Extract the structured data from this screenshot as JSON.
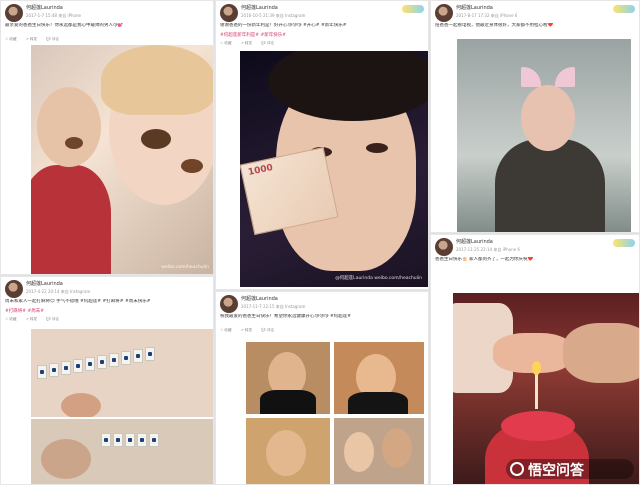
{
  "posts": [
    {
      "username": "何超莲Laurinda",
      "meta": "2017-1-7 15:48 来自 iPhone",
      "text": "最亲爱的爸爸生日快乐！你永远都是我心中最帅的男人😘💕",
      "tags": "",
      "watermark": "weibo.com/heachulin",
      "face_marks": [
        "◕ᴥ◕",
        "• •"
      ]
    },
    {
      "username": "何超莲Laurinda",
      "meta": "2016-10-5 21:39 来自 Instagram",
      "text": "谢谢爸爸的一份新年利是！好开心😘😘😘 #开心# #新年快乐#",
      "tags": "#何超莲新年利是# #新年快乐#",
      "watermark": "@何超莲Laurinda weibo.com/heachulin",
      "note_label": "1000"
    },
    {
      "username": "何超莲Laurinda",
      "meta": "2017-8-17 17:32 来自 iPhone 6",
      "text": "陪爸爸一起看电视，他最近身体很好，大家都不用担心啦❤️",
      "tags": "",
      "watermark": ""
    },
    {
      "username": "何超莲Laurinda",
      "meta": "2017-4-22 20:14 来自 Instagram",
      "text": "周末和家人一起打麻将😊 手气不错哦 #何超莲# #打麻将# #周末快乐#",
      "tags": "#打麻将# #周末#",
      "watermark": ""
    },
    {
      "username": "何超莲Laurinda",
      "meta": "2017-11-7 22:15 来自 Instagram",
      "text": "祝我最爱的爸爸生日快乐！希望你永远健康开心😘😘😘 #何超莲#",
      "tags": "",
      "watermark": ""
    },
    {
      "username": "何超莲Laurinda",
      "meta": "2017-11-25 22:14 来自 iPhone 6",
      "text": "爸爸生日快乐🎂 家人都到齐了，一起为你庆祝❤️",
      "tags": "",
      "watermark": ""
    }
  ],
  "actions": [
    "☆ 收藏",
    "↗ 转发",
    "💬 评论",
    "👍 点赞"
  ],
  "brand": {
    "text": "悟空问答"
  },
  "colors": {
    "background": "#dfe3e8",
    "tag_pink": "#d23a6a"
  },
  "icons": [
    "avatar",
    "hat-badge",
    "wukong-icon"
  ]
}
